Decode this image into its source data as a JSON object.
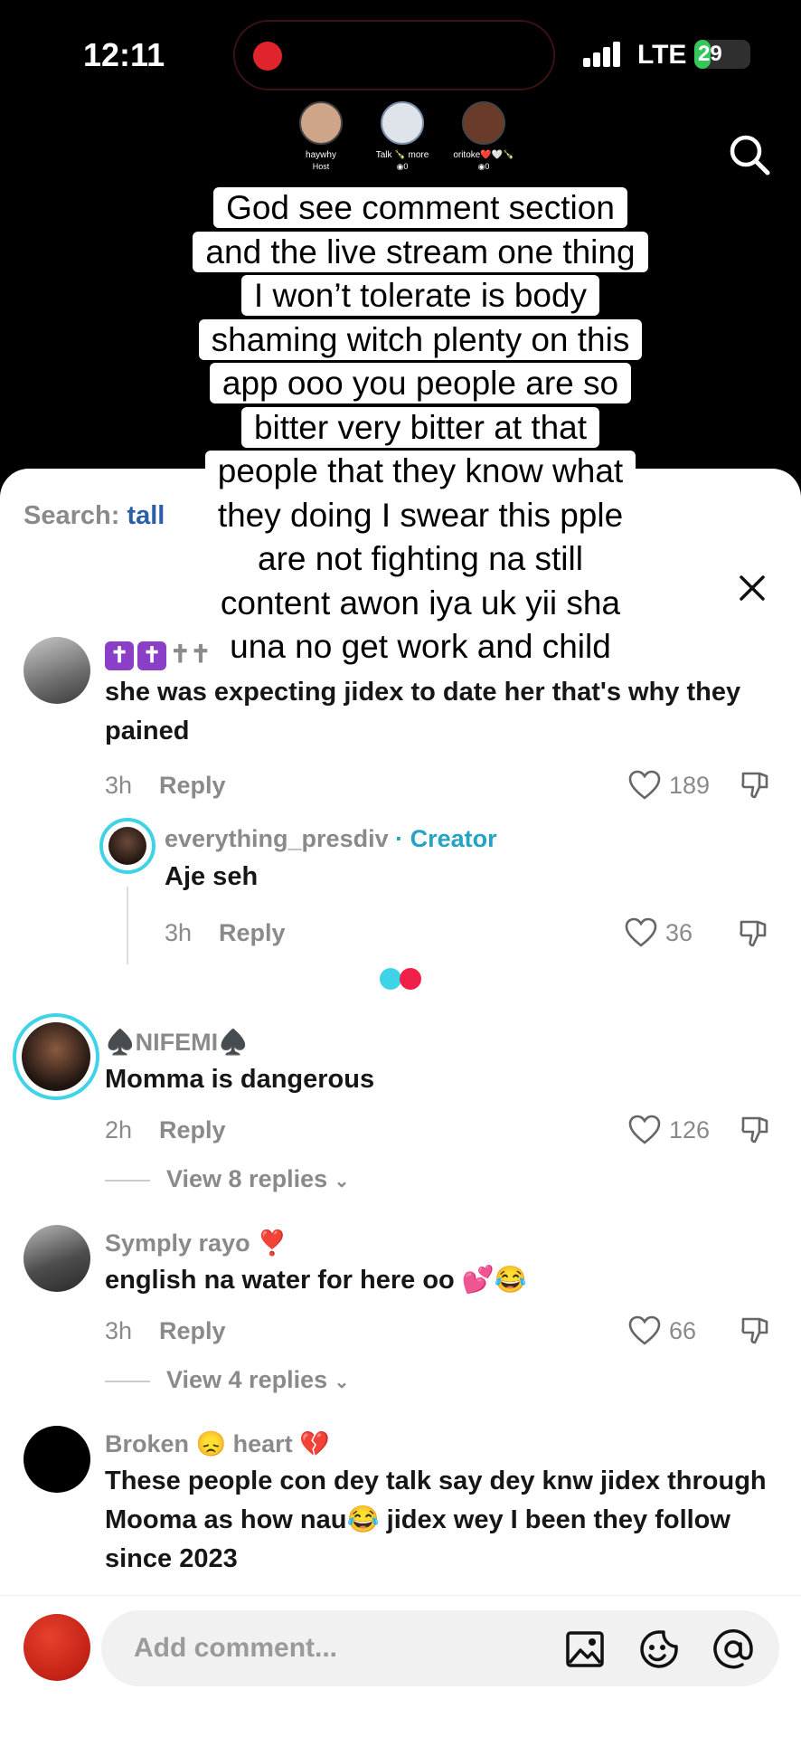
{
  "status": {
    "time": "12:11",
    "network": "LTE",
    "battery": "29",
    "battery_level": 0.29
  },
  "live": {
    "users": [
      {
        "name": "haywhy",
        "sub": "Host"
      },
      {
        "name": "Talk 🍾 more",
        "sub": "◉0"
      },
      {
        "name": "oritoke❤️🤍🍾",
        "sub": "◉0"
      }
    ]
  },
  "caption": {
    "lines": [
      "God see comment section",
      "and the live stream one thing",
      "I won’t tolerate is body",
      "shaming witch plenty on this",
      "app ooo you people are so",
      "bitter very bitter at that",
      "people that they know what",
      "they doing I swear this pple",
      "are not fighting na still",
      "content awon iya uk yii sha",
      "una no get work and child"
    ]
  },
  "sheet": {
    "search_prefix": "Search:",
    "search_term": "tall"
  },
  "comments": [
    {
      "user": "✝✝ M",
      "text": "she was expecting jidex to date her that's why they pained",
      "time": "3h",
      "reply": "Reply",
      "likes": "189"
    },
    {
      "user": "everything_presdiv",
      "creator": "· Creator",
      "text": "Aje seh",
      "time": "3h",
      "reply": "Reply",
      "likes": "36"
    },
    {
      "user": "♠️NIFEMI♠️",
      "text": "Momma is dangerous",
      "time": "2h",
      "reply": "Reply",
      "likes": "126",
      "view_replies": "View 8 replies"
    },
    {
      "user": "Symply rayo ❣️",
      "text": "english na water for here oo 💕😂",
      "time": "3h",
      "reply": "Reply",
      "likes": "66",
      "view_replies": "View 4 replies"
    },
    {
      "user": "Broken 😞 heart 💔",
      "text": "These people con dey talk say dey knw jidex through Mooma as how nau😂 jidex wey I been they follow since 2023"
    }
  ],
  "bottom": {
    "placeholder": "Add comment..."
  },
  "colors": {
    "accent": "#25a3c4",
    "loader_a": "#3fd3e8",
    "loader_b": "#f0204a"
  }
}
